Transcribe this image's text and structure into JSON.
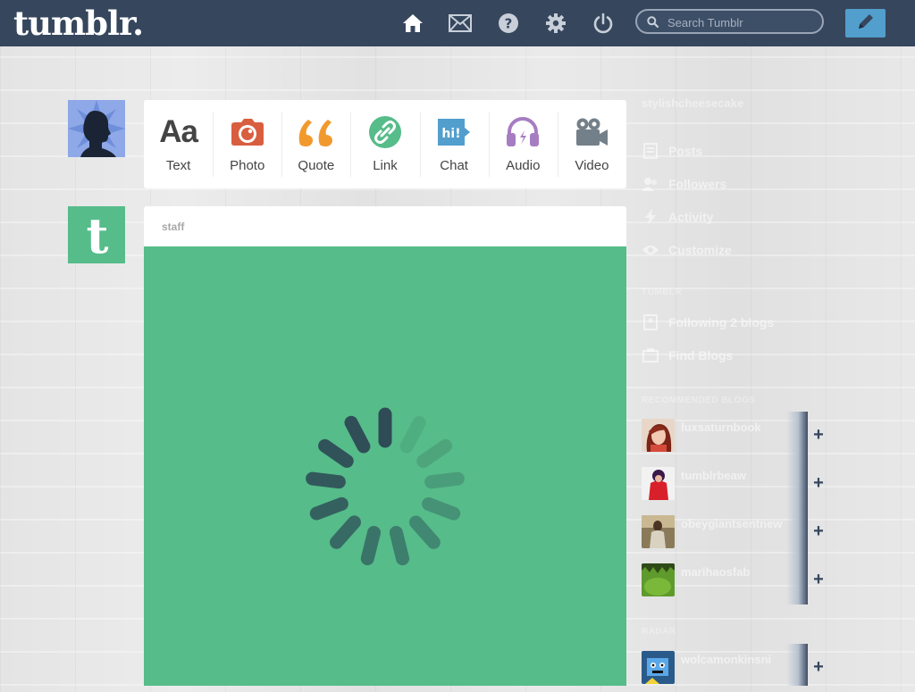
{
  "header": {
    "logo": "tumblr.",
    "search_placeholder": "Search Tumblr",
    "nav_icons": [
      "home-icon",
      "mail-icon",
      "help-icon",
      "gear-icon",
      "power-icon"
    ],
    "compose_icon": "pencil-icon"
  },
  "post_types": [
    {
      "label": "Text",
      "glyph": "Aa",
      "color": "#444444"
    },
    {
      "label": "Photo",
      "color": "#d95e40"
    },
    {
      "label": "Quote",
      "glyph": "❝",
      "color": "#f2992e"
    },
    {
      "label": "Link",
      "color": "#56bc8a"
    },
    {
      "label": "Chat",
      "glyph": "hi!",
      "color": "#529ecc"
    },
    {
      "label": "Audio",
      "color": "#a77dc2"
    },
    {
      "label": "Video",
      "color": "#748089"
    }
  ],
  "post": {
    "author": "staff",
    "background": "#56bc8a"
  },
  "sidebar": {
    "blog_name": "stylishcheesecake",
    "items": [
      {
        "label": "Posts",
        "icon": "posts-icon"
      },
      {
        "label": "Followers",
        "icon": "followers-icon"
      },
      {
        "label": "Activity",
        "icon": "activity-icon"
      },
      {
        "label": "Customize",
        "icon": "eye-icon"
      }
    ],
    "section_label": "TUMBLR",
    "following_items": [
      {
        "label": "Following 2 blogs",
        "icon": "following-icon"
      },
      {
        "label": "Find Blogs",
        "icon": "find-icon"
      }
    ],
    "recommended_label": "RECOMMENDED BLOGS",
    "recommended": [
      {
        "name": "luxsaturnbook"
      },
      {
        "name": "tumblrbeaw"
      },
      {
        "name": "obeygiantsentnew"
      },
      {
        "name": "marihaosfab"
      }
    ],
    "radar_label": "RADAR",
    "radar": {
      "name": "wolcamonkinsni"
    }
  },
  "colors": {
    "header": "#36465d",
    "accent": "#529ecc",
    "green": "#56bc8a"
  }
}
